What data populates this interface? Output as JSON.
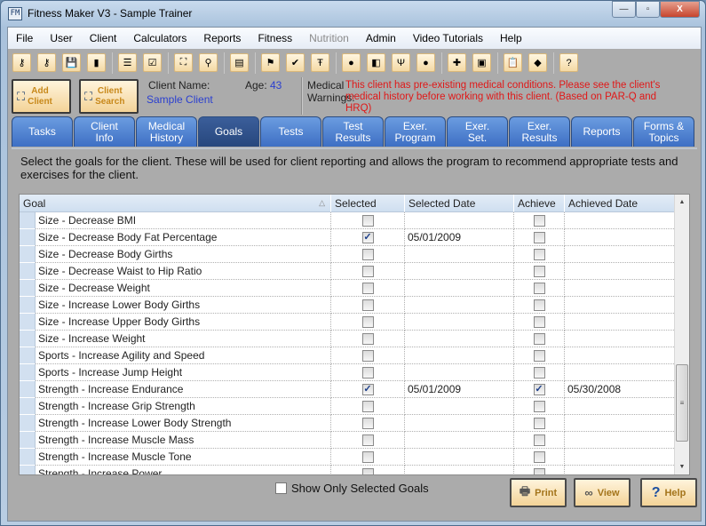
{
  "window": {
    "title": "Fitness Maker V3 - Sample Trainer",
    "app_icon_text": "FM",
    "controls": {
      "minimize": "—",
      "maximize": "▫",
      "close": "X"
    }
  },
  "menu": [
    {
      "label": "File",
      "disabled": false
    },
    {
      "label": "User",
      "disabled": false
    },
    {
      "label": "Client",
      "disabled": false
    },
    {
      "label": "Calculators",
      "disabled": false
    },
    {
      "label": "Reports",
      "disabled": false
    },
    {
      "label": "Fitness",
      "disabled": false
    },
    {
      "label": "Nutrition",
      "disabled": true
    },
    {
      "label": "Admin",
      "disabled": false
    },
    {
      "label": "Video Tutorials",
      "disabled": false
    },
    {
      "label": "Help",
      "disabled": false
    }
  ],
  "toolbar": [
    {
      "icon": "key-login-icon",
      "glyph": "⚷"
    },
    {
      "icon": "key-logout-icon",
      "glyph": "⚷"
    },
    {
      "icon": "save-icon",
      "glyph": "💾"
    },
    {
      "icon": "exit-door-icon",
      "glyph": "▮"
    },
    "sep",
    {
      "icon": "list-icon",
      "glyph": "☰"
    },
    {
      "icon": "checklist-icon",
      "glyph": "☑"
    },
    "sep",
    {
      "icon": "add-client-icon",
      "glyph": "⛶"
    },
    {
      "icon": "search-icon",
      "glyph": "⚲"
    },
    "sep",
    {
      "icon": "scroll-icon",
      "glyph": "▤"
    },
    "sep",
    {
      "icon": "checkered-flag-icon",
      "glyph": "⚑"
    },
    {
      "icon": "checked-document-icon",
      "glyph": "✔"
    },
    {
      "icon": "weightlifter-icon",
      "glyph": "Ŧ"
    },
    "sep",
    {
      "icon": "apple-icon",
      "glyph": "●"
    },
    {
      "icon": "drink-icon",
      "glyph": "◧"
    },
    {
      "icon": "fork-icon",
      "glyph": "Ψ"
    },
    {
      "icon": "tomato-icon",
      "glyph": "●"
    },
    "sep",
    {
      "icon": "new-document-icon",
      "glyph": "✚"
    },
    {
      "icon": "form-icon",
      "glyph": "▣"
    },
    "sep",
    {
      "icon": "clipboard-icon",
      "glyph": "📋"
    },
    {
      "icon": "whistle-icon",
      "glyph": "◆"
    },
    "sep",
    {
      "icon": "help-icon",
      "glyph": "?"
    }
  ],
  "client_strip": {
    "add_client": "Add\nClient",
    "client_search": "Client\nSearch",
    "client_name_label": "Client Name:",
    "client_name": "Sample Client",
    "age_label": "Age:",
    "age": "43",
    "medical_label": "Medical\nWarnings:",
    "medical_warning": "This client has pre-existing medical conditions. Please see the client's medical history before working with this client.  (Based on PAR-Q and HRQ)"
  },
  "tabs": [
    {
      "label": "Tasks",
      "active": false
    },
    {
      "label": "Client\nInfo",
      "active": false
    },
    {
      "label": "Medical\nHistory",
      "active": false
    },
    {
      "label": "Goals",
      "active": true
    },
    {
      "label": "Tests",
      "active": false
    },
    {
      "label": "Test\nResults",
      "active": false
    },
    {
      "label": "Exer.\nProgram",
      "active": false
    },
    {
      "label": "Exer.\nSet.",
      "active": false
    },
    {
      "label": "Exer.\nResults",
      "active": false
    },
    {
      "label": "Reports",
      "active": false
    },
    {
      "label": "Forms &\nTopics",
      "active": false
    }
  ],
  "goals": {
    "description": "Select the goals for the client. These will be used for client reporting and allows the program to recommend  appropriate tests and exercises for the client.",
    "columns": [
      "Goal",
      "Selected",
      "Selected Date",
      "Achieve",
      "Achieved Date"
    ],
    "rows": [
      {
        "goal": "Size - Decrease BMI",
        "selected": false,
        "selected_date": "",
        "achieve": false,
        "achieved_date": ""
      },
      {
        "goal": "Size - Decrease Body Fat Percentage",
        "selected": true,
        "selected_date": "05/01/2009",
        "achieve": false,
        "achieved_date": ""
      },
      {
        "goal": "Size - Decrease Body Girths",
        "selected": false,
        "selected_date": "",
        "achieve": false,
        "achieved_date": ""
      },
      {
        "goal": "Size - Decrease Waist to Hip Ratio",
        "selected": false,
        "selected_date": "",
        "achieve": false,
        "achieved_date": ""
      },
      {
        "goal": "Size - Decrease Weight",
        "selected": false,
        "selected_date": "",
        "achieve": false,
        "achieved_date": ""
      },
      {
        "goal": "Size - Increase Lower Body Girths",
        "selected": false,
        "selected_date": "",
        "achieve": false,
        "achieved_date": ""
      },
      {
        "goal": "Size - Increase Upper Body Girths",
        "selected": false,
        "selected_date": "",
        "achieve": false,
        "achieved_date": ""
      },
      {
        "goal": "Size - Increase Weight",
        "selected": false,
        "selected_date": "",
        "achieve": false,
        "achieved_date": ""
      },
      {
        "goal": "Sports - Increase Agility and Speed",
        "selected": false,
        "selected_date": "",
        "achieve": false,
        "achieved_date": ""
      },
      {
        "goal": "Sports - Increase Jump Height",
        "selected": false,
        "selected_date": "",
        "achieve": false,
        "achieved_date": ""
      },
      {
        "goal": "Strength - Increase Endurance",
        "selected": true,
        "selected_date": "05/01/2009",
        "achieve": true,
        "achieved_date": "05/30/2008"
      },
      {
        "goal": "Strength - Increase Grip Strength",
        "selected": false,
        "selected_date": "",
        "achieve": false,
        "achieved_date": ""
      },
      {
        "goal": "Strength - Increase Lower Body Strength",
        "selected": false,
        "selected_date": "",
        "achieve": false,
        "achieved_date": ""
      },
      {
        "goal": "Strength - Increase Muscle Mass",
        "selected": false,
        "selected_date": "",
        "achieve": false,
        "achieved_date": ""
      },
      {
        "goal": "Strength - Increase Muscle Tone",
        "selected": false,
        "selected_date": "",
        "achieve": false,
        "achieved_date": ""
      },
      {
        "goal": "Strength - Increase Power",
        "selected": false,
        "selected_date": "",
        "achieve": false,
        "achieved_date": ""
      }
    ],
    "show_only_selected_label": "Show Only Selected Goals",
    "show_only_selected": false
  },
  "buttons": {
    "print": "Print",
    "view": "View",
    "help": "Help"
  }
}
